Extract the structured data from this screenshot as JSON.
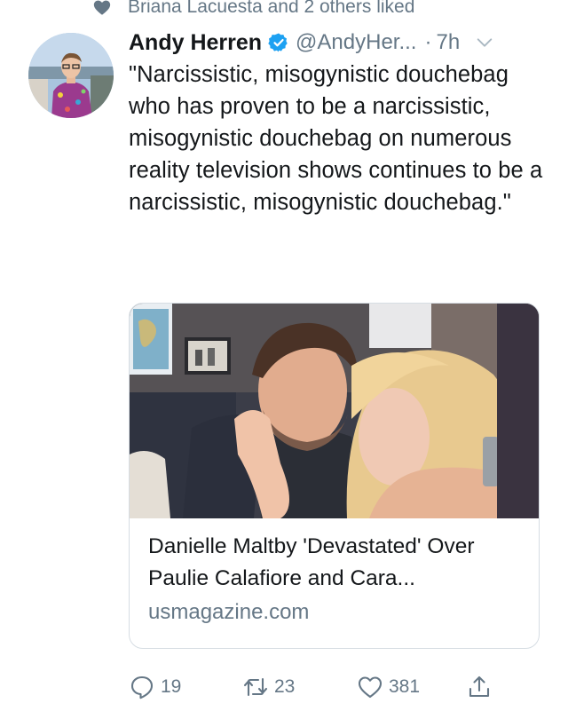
{
  "social_context": {
    "text": "Briana Lacuesta and 2 others liked"
  },
  "tweet": {
    "author_name": "Andy Herren",
    "handle": "@AndyHer...",
    "separator": "·",
    "time": "7h",
    "text": "\"Narcissistic, misogynistic douchebag who has proven to be a narcissistic, misogynistic douchebag on numerous reality television shows continues to be a narcissistic, misogynistic douchebag.\""
  },
  "card": {
    "title": "Danielle Maltby 'Devastated' Over Paulie Calafiore and Cara...",
    "domain": "usmagazine.com"
  },
  "actions": {
    "reply_count": "19",
    "retweet_count": "23",
    "like_count": "381"
  },
  "colors": {
    "accent": "#1da1f2",
    "text": "#14171a",
    "muted": "#657786",
    "border": "#d6dde3"
  },
  "icons": [
    "heart-icon",
    "verified-badge-icon",
    "chevron-down-icon",
    "reply-icon",
    "retweet-icon",
    "like-icon",
    "share-icon"
  ]
}
